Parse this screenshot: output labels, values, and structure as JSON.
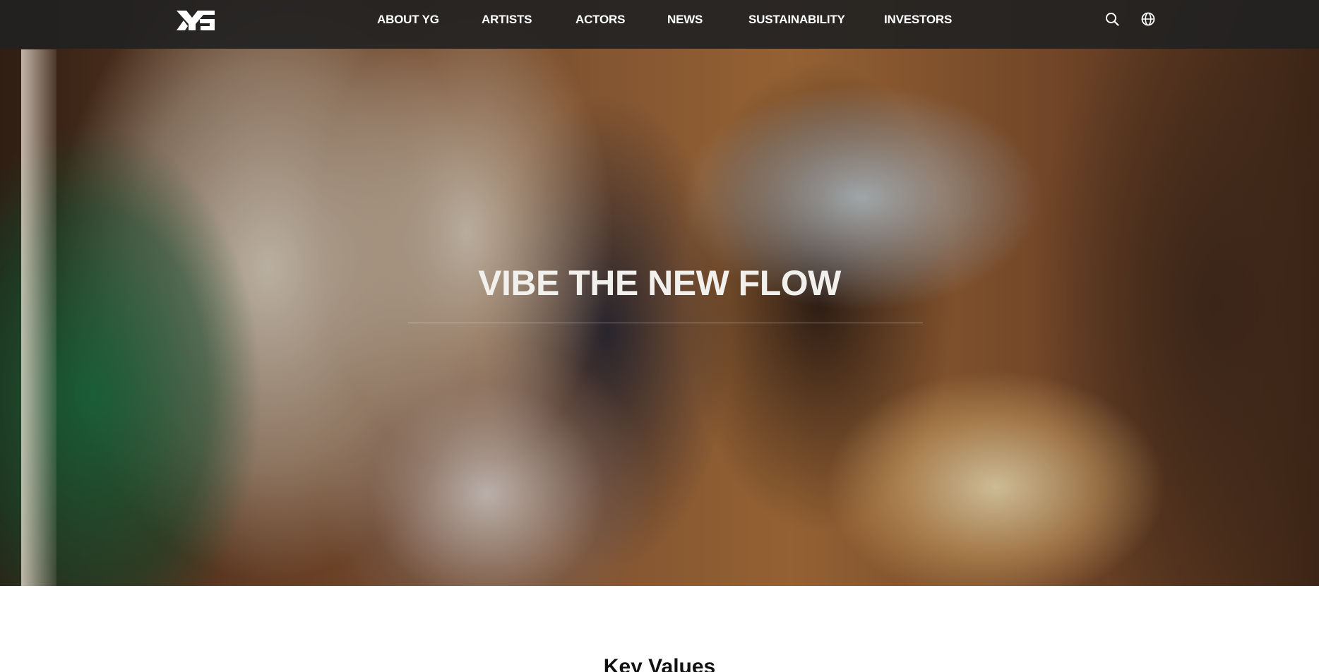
{
  "nav": {
    "logo_icon": "yg-logo-icon",
    "items": [
      {
        "label": "ABOUT YG"
      },
      {
        "label": "ARTISTS"
      },
      {
        "label": "ACTORS"
      },
      {
        "label": "NEWS"
      },
      {
        "label": "SUSTAINABILITY"
      },
      {
        "label": "INVESTORS"
      }
    ],
    "search_icon": "search-icon",
    "language_icon": "globe-icon"
  },
  "hero": {
    "headline": "VIBE THE NEW FLOW"
  },
  "section": {
    "title": "Key Values"
  },
  "colors": {
    "nav_background": "#222222",
    "nav_text": "#ffffff",
    "headline_text": "#f2f0ec",
    "section_title": "#111111"
  }
}
